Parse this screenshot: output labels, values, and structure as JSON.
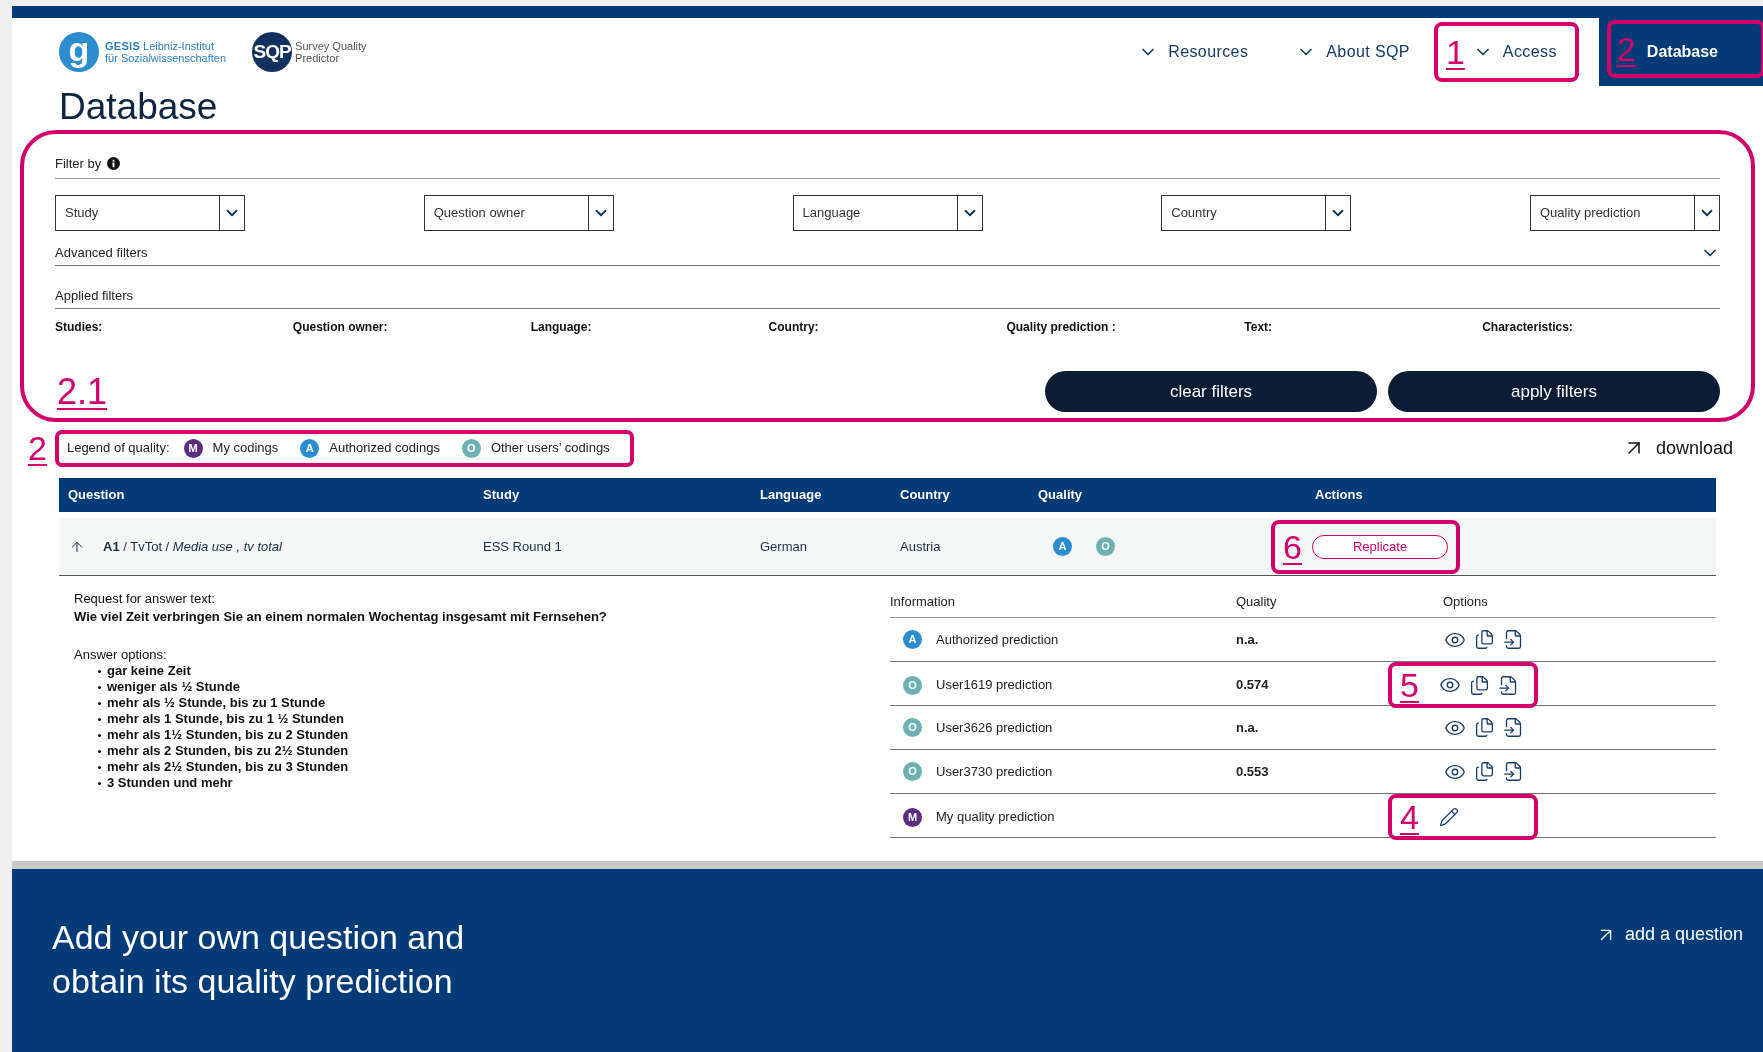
{
  "header": {
    "gesis_mark": "g",
    "gesis_name": "GESIS",
    "gesis_line1": "Leibniz-Institut",
    "gesis_line2": "für Sozialwissenschaften",
    "sqp_mark": "SQP",
    "sqp_line1": "Survey Quality",
    "sqp_line2": "Predictor",
    "nav": [
      {
        "label": "Resources",
        "selected": false
      },
      {
        "label": "About SQP",
        "selected": false
      },
      {
        "label": "Access",
        "selected": false,
        "annotation": "1"
      },
      {
        "label": "Database",
        "selected": true,
        "annotation": "2"
      }
    ]
  },
  "page_title": "Database",
  "filters": {
    "annotation": "2.1",
    "label": "Filter by",
    "dropdowns": [
      "Study",
      "Question owner",
      "Language",
      "Country",
      "Quality prediction"
    ],
    "advanced": "Advanced filters",
    "applied_title": "Applied filters",
    "applied": [
      "Studies:",
      "Question owner:",
      "Language:",
      "Country:",
      "Quality prediction :",
      "Text:",
      "Characteristics:"
    ],
    "buttons": [
      "clear filters",
      "apply filters"
    ]
  },
  "legend": {
    "annotation": "2",
    "label": "Legend of quality:",
    "items": [
      {
        "badge": "M",
        "label": "My codings",
        "color": "#5a2d82"
      },
      {
        "badge": "A",
        "label": "Authorized codings",
        "color": "#2b8ccf"
      },
      {
        "badge": "O",
        "label": "Other users’ codings",
        "color": "#6fb0b2"
      }
    ]
  },
  "download": "download",
  "table": {
    "columns": [
      "Question",
      "Study",
      "Language",
      "Country",
      "Quality",
      "Actions"
    ],
    "rows": [
      {
        "question": "**A1** / TvTot / *Media use , tv total*",
        "study": "ESS Round 1",
        "language": "German",
        "country": "Austria",
        "expanded": true,
        "quality": [
          {
            "badge": "A",
            "color": "#2b8ccf"
          },
          {
            "badge": "O",
            "color": "#6fb0b2"
          }
        ],
        "action": "Replicate",
        "action_annotation": "6"
      }
    ]
  },
  "details": {
    "request_label": "Request for answer text:",
    "request_text": "Wie viel Zeit verbringen Sie an einem normalen Wochentag insgesamt mit Fernsehen?",
    "options_label": "Answer options:",
    "options": [
      "gar keine Zeit",
      "weniger als ½ Stunde",
      "mehr als ½ Stunde, bis zu 1 Stunde",
      "mehr als 1 Stunde, bis zu 1 ½ Stunden",
      "mehr als 1½ Stunden, bis zu 2 Stunden",
      "mehr als 2 Stunden, bis zu 2½ Stunden",
      "mehr als 2½ Stunden, bis zu 3 Stunden",
      "3 Stunden und mehr"
    ],
    "columns": [
      "Information",
      "Quality",
      "Options"
    ],
    "predictions": [
      {
        "badge": "A",
        "color": "#2b8ccf",
        "label": "Authorized prediction",
        "quality": "n.a.",
        "kind": "view"
      },
      {
        "badge": "O",
        "color": "#6fb0b2",
        "label": "User1619 prediction",
        "quality": "0.574",
        "kind": "view",
        "annotation": "5"
      },
      {
        "badge": "O",
        "color": "#6fb0b2",
        "label": "User3626 prediction",
        "quality": "n.a.",
        "kind": "view"
      },
      {
        "badge": "O",
        "color": "#6fb0b2",
        "label": "User3730 prediction",
        "quality": "0.553",
        "kind": "view"
      },
      {
        "badge": "M",
        "color": "#5a2d82",
        "label": "My quality prediction",
        "kind": "edit",
        "annotation": "4"
      }
    ]
  },
  "footer": {
    "heading": [
      "Add your own question and",
      "obtain its quality prediction"
    ],
    "link": "add a question"
  }
}
